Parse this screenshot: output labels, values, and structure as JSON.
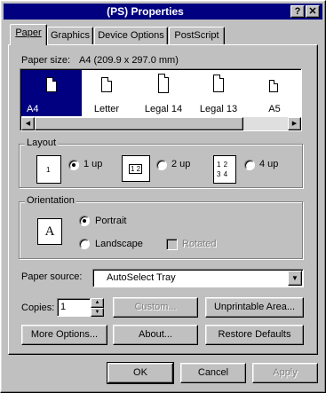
{
  "window": {
    "title": "(PS) Properties",
    "help_glyph": "?",
    "close_glyph": "✕"
  },
  "tabs": [
    {
      "label": "Paper",
      "active": true
    },
    {
      "label": "Graphics"
    },
    {
      "label": "Device Options"
    },
    {
      "label": "PostScript"
    }
  ],
  "paper": {
    "size_label": "Paper size:",
    "size_value": "A4 (209.9 x 297.0 mm)",
    "items": [
      {
        "label": "A4",
        "selected": true
      },
      {
        "label": "Letter"
      },
      {
        "label": "Legal 14"
      },
      {
        "label": "Legal 13"
      },
      {
        "label": "A5"
      }
    ],
    "scroll_left": "◀",
    "scroll_right": "▶"
  },
  "layout": {
    "title": "Layout",
    "options": [
      {
        "label": "1 up",
        "icon": "1",
        "selected": true
      },
      {
        "label": "2 up",
        "icon": "1 2"
      },
      {
        "label": "4 up",
        "icon": "1 2 3 4"
      }
    ]
  },
  "orientation": {
    "title": "Orientation",
    "preview_glyph": "A",
    "portrait": "Portrait",
    "landscape": "Landscape",
    "rotated": "Rotated"
  },
  "source": {
    "label": "Paper source:",
    "value": "AutoSelect Tray"
  },
  "copies": {
    "label": "Copies:",
    "value": "1"
  },
  "buttons": {
    "custom": "Custom...",
    "unprintable": "Unprintable Area...",
    "more_options": "More Options...",
    "about": "About...",
    "restore": "Restore Defaults",
    "ok": "OK",
    "cancel": "Cancel",
    "apply": "Apply"
  }
}
